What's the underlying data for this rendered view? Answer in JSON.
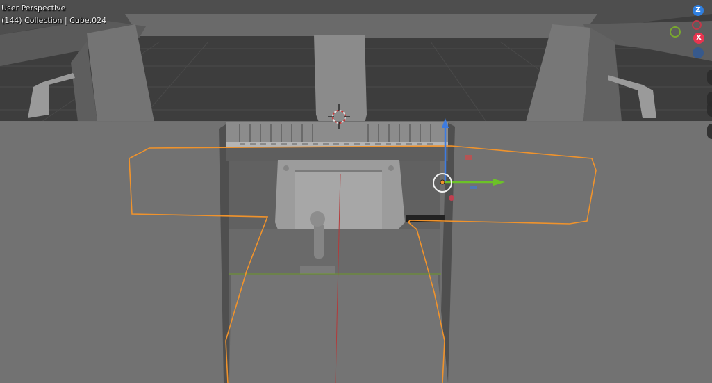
{
  "viewport": {
    "mode_label": "User Perspective",
    "info_label": "(144) Collection | Cube.024"
  },
  "gizmo": {
    "z_label": "Z",
    "x_label": "X",
    "colors": {
      "x": "#e8344f",
      "y": "#79a82e",
      "z": "#2f7fe0"
    }
  },
  "selection": {
    "outline_color": "#f0932c"
  },
  "icons": [
    "3d-cursor-icon",
    "navigation-gizmo",
    "transform-gizmo"
  ]
}
